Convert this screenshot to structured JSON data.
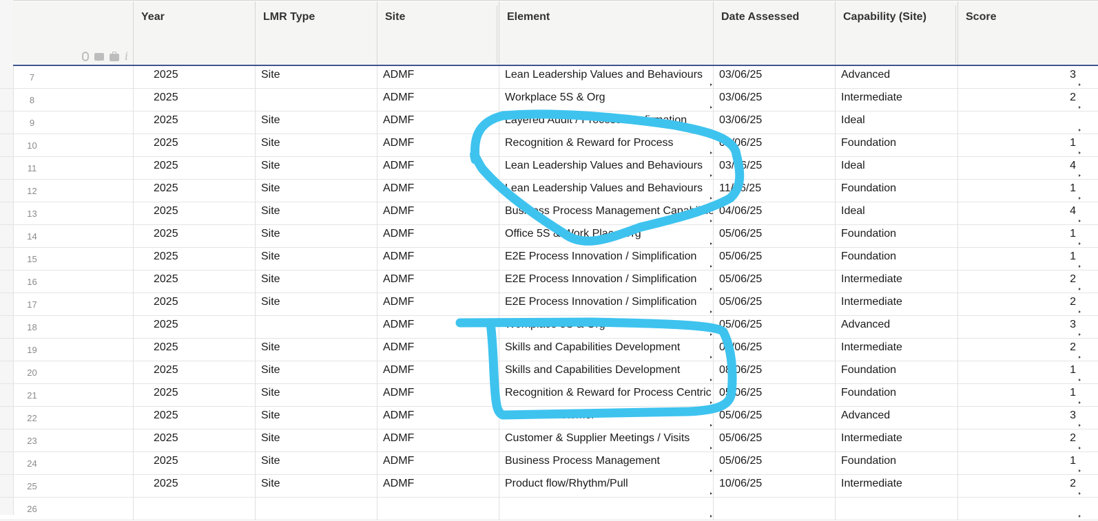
{
  "columns": {
    "year": "Year",
    "lmr_type": "LMR Type",
    "site": "Site",
    "element": "Element",
    "date_assessed": "Date Assessed",
    "capability": "Capability (Site)",
    "score": "Score"
  },
  "row_tools": [
    "attachment-icon",
    "comment-icon",
    "proof-icon",
    "info-icon"
  ],
  "rows": [
    {
      "num": "7",
      "year": "2025",
      "lmr_type": "Site",
      "site": "ADMF",
      "element": "Lean Leadership Values and Behaviours",
      "date": "03/06/25",
      "capability": "Advanced",
      "score": "3"
    },
    {
      "num": "8",
      "year": "2025",
      "lmr_type": "",
      "site": "ADMF",
      "element": "Workplace 5S & Org",
      "date": "03/06/25",
      "capability": "Intermediate",
      "score": "2"
    },
    {
      "num": "9",
      "year": "2025",
      "lmr_type": "Site",
      "site": "ADMF",
      "element": "Layered Audit / Process Confirmation",
      "date": "03/06/25",
      "capability": "Ideal",
      "score": ""
    },
    {
      "num": "10",
      "year": "2025",
      "lmr_type": "Site",
      "site": "ADMF",
      "element": "Recognition & Reward for Process",
      "date": "03/06/25",
      "capability": "Foundation",
      "score": "1"
    },
    {
      "num": "11",
      "year": "2025",
      "lmr_type": "Site",
      "site": "ADMF",
      "element": "Lean Leadership Values and Behaviours",
      "date": "03/06/25",
      "capability": "Ideal",
      "score": "4"
    },
    {
      "num": "12",
      "year": "2025",
      "lmr_type": "Site",
      "site": "ADMF",
      "element": "Lean Leadership Values and Behaviours",
      "date": "11/06/25",
      "capability": "Foundation",
      "score": "1"
    },
    {
      "num": "13",
      "year": "2025",
      "lmr_type": "Site",
      "site": "ADMF",
      "element": "Business Process Management Capabilitie",
      "date": "04/06/25",
      "capability": "Ideal",
      "score": "4"
    },
    {
      "num": "14",
      "year": "2025",
      "lmr_type": "Site",
      "site": "ADMF",
      "element": "Office 5S & Work Place Org",
      "date": "05/06/25",
      "capability": "Foundation",
      "score": "1"
    },
    {
      "num": "15",
      "year": "2025",
      "lmr_type": "Site",
      "site": "ADMF",
      "element": "E2E Process Innovation / Simplification",
      "date": "05/06/25",
      "capability": "Foundation",
      "score": "1"
    },
    {
      "num": "16",
      "year": "2025",
      "lmr_type": "Site",
      "site": "ADMF",
      "element": "E2E Process Innovation / Simplification",
      "date": "05/06/25",
      "capability": "Intermediate",
      "score": "2"
    },
    {
      "num": "17",
      "year": "2025",
      "lmr_type": "Site",
      "site": "ADMF",
      "element": "E2E Process Innovation / Simplification",
      "date": "05/06/25",
      "capability": "Intermediate",
      "score": "2"
    },
    {
      "num": "18",
      "year": "2025",
      "lmr_type": "",
      "site": "ADMF",
      "element": "Workplace 5S & Org",
      "date": "05/06/25",
      "capability": "Advanced",
      "score": "3"
    },
    {
      "num": "19",
      "year": "2025",
      "lmr_type": "Site",
      "site": "ADMF",
      "element": "Skills and Capabilities Development",
      "date": "05/06/25",
      "capability": "Intermediate",
      "score": "2"
    },
    {
      "num": "20",
      "year": "2025",
      "lmr_type": "Site",
      "site": "ADMF",
      "element": "Skills and Capabilities Development",
      "date": "08/06/25",
      "capability": "Foundation",
      "score": "1"
    },
    {
      "num": "21",
      "year": "2025",
      "lmr_type": "Site",
      "site": "ADMF",
      "element": "Recognition & Reward for Process Centric",
      "date": "05/06/25",
      "capability": "Foundation",
      "score": "1"
    },
    {
      "num": "22",
      "year": "2025",
      "lmr_type": "Site",
      "site": "ADMF",
      "element": "Voice of Customer",
      "date": "05/06/25",
      "capability": "Advanced",
      "score": "3"
    },
    {
      "num": "23",
      "year": "2025",
      "lmr_type": "Site",
      "site": "ADMF",
      "element": "Customer & Supplier Meetings / Visits",
      "date": "05/06/25",
      "capability": "Intermediate",
      "score": "2"
    },
    {
      "num": "24",
      "year": "2025",
      "lmr_type": "Site",
      "site": "ADMF",
      "element": "Business Process Management",
      "date": "05/06/25",
      "capability": "Foundation",
      "score": "1"
    },
    {
      "num": "25",
      "year": "2025",
      "lmr_type": "Site",
      "site": "ADMF",
      "element": "Product flow/Rhythm/Pull",
      "date": "10/06/25",
      "capability": "Intermediate",
      "score": "2"
    },
    {
      "num": "26",
      "year": "",
      "lmr_type": "",
      "site": "",
      "element": "",
      "date": "",
      "capability": "",
      "score": ""
    }
  ],
  "annotation_color": "#3ec3ef"
}
